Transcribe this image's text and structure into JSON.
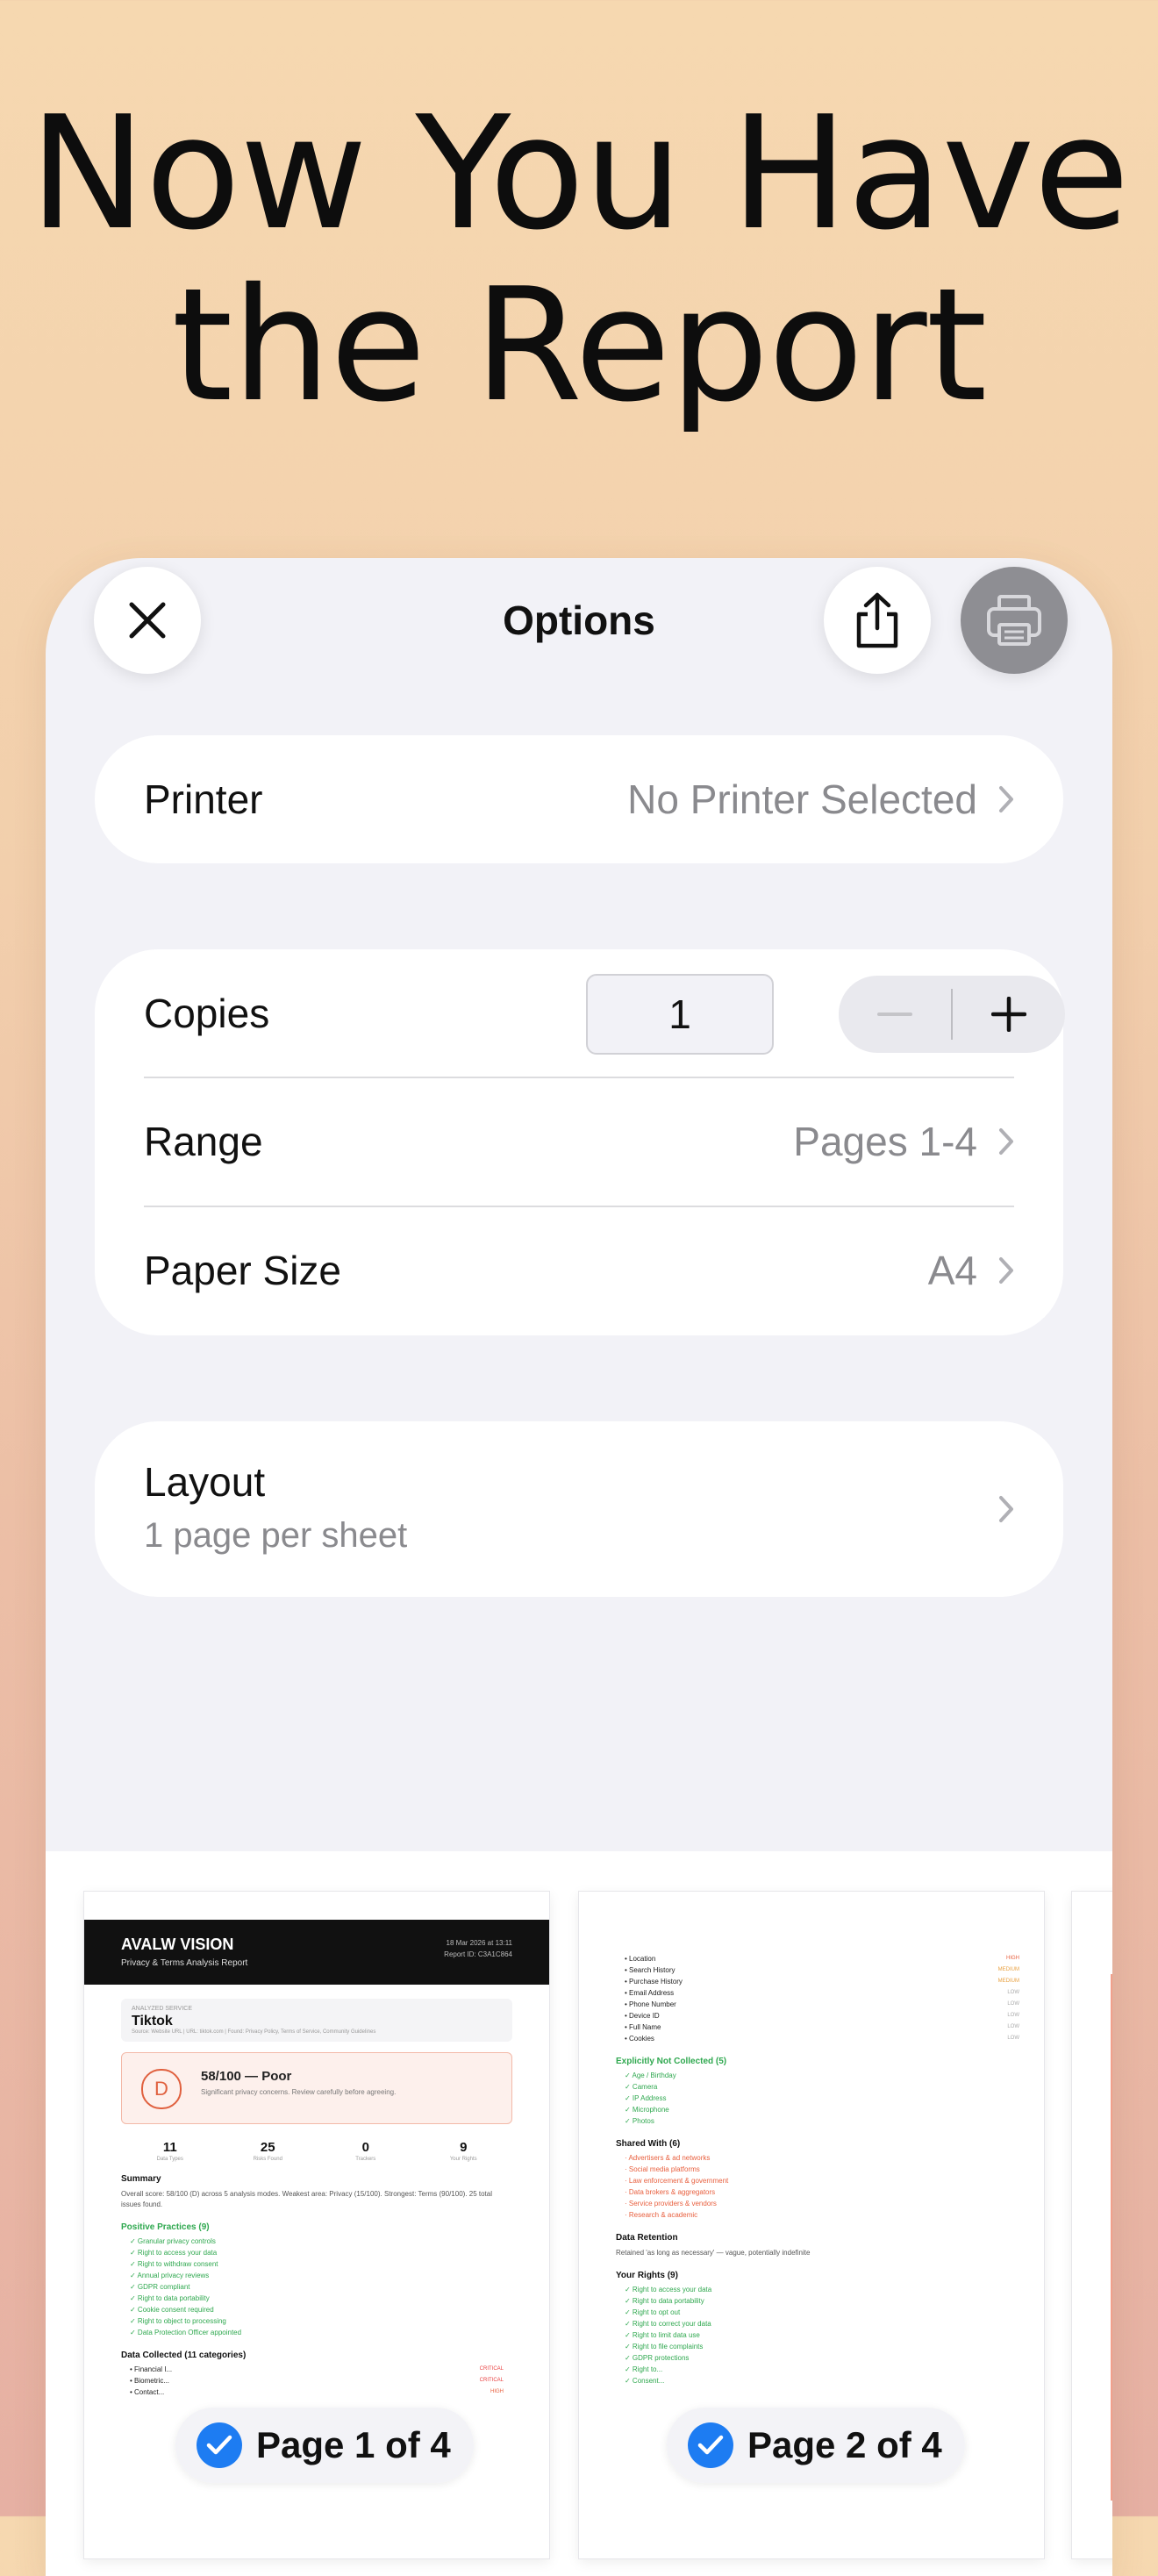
{
  "headline": {
    "line1": "Now You Have",
    "line2": "the Report"
  },
  "sheet": {
    "title": "Options",
    "close_icon": "close-icon",
    "share_icon": "share-icon",
    "print_icon": "printer-icon"
  },
  "printer": {
    "label": "Printer",
    "value": "No Printer Selected"
  },
  "copies": {
    "label": "Copies",
    "value": "1"
  },
  "range": {
    "label": "Range",
    "value": "Pages 1-4"
  },
  "paper_size": {
    "label": "Paper Size",
    "value": "A4"
  },
  "layout": {
    "label": "Layout",
    "value": "1 page per sheet"
  },
  "pages": {
    "page1_label": "Page 1 of 4",
    "page2_label": "Page 2 of 4"
  },
  "report_p1": {
    "brand": "AVALW VISION",
    "subtitle": "Privacy & Terms Analysis Report",
    "meta1": "18 Mar 2026 at 13:11",
    "meta2": "Report ID: C3A1C864",
    "service_caption": "ANALYZED SERVICE",
    "service_name": "Tiktok",
    "service_source": "Source: Website URL | URL: tiktok.com | Found: Privacy Policy, Terms of Service, Community Guidelines",
    "grade": "D",
    "score": "58/100 — Poor",
    "score_note": "Significant privacy concerns. Review carefully before agreeing.",
    "stats": [
      {
        "n": "11",
        "l": "Data Types"
      },
      {
        "n": "25",
        "l": "Risks Found"
      },
      {
        "n": "0",
        "l": "Trackers"
      },
      {
        "n": "9",
        "l": "Your Rights"
      }
    ],
    "summary_title": "Summary",
    "summary_text": "Overall score: 58/100 (D) across 5 analysis modes. Weakest area: Privacy (15/100). Strongest: Terms (90/100). 25 total issues found.",
    "positive_title": "Positive Practices (9)",
    "positive": [
      "✓ Granular privacy controls",
      "✓ Right to access your data",
      "✓ Right to withdraw consent",
      "✓ Annual privacy reviews",
      "✓ GDPR compliant",
      "✓ Right to data portability",
      "✓ Cookie consent required",
      "✓ Right to object to processing",
      "✓ Data Protection Officer appointed"
    ],
    "collected_title": "Data Collected (11 categories)",
    "collected": [
      {
        "t": "• Financial I...",
        "tag": "CRITICAL"
      },
      {
        "t": "• Biometric...",
        "tag": "CRITICAL"
      },
      {
        "t": "• Contact...",
        "tag": "HIGH"
      }
    ]
  },
  "report_p2": {
    "list": [
      {
        "t": "• Location",
        "tag": "HIGH"
      },
      {
        "t": "• Search History",
        "tag": "MEDIUM"
      },
      {
        "t": "• Purchase History",
        "tag": "MEDIUM"
      },
      {
        "t": "• Email Address",
        "tag": "LOW"
      },
      {
        "t": "• Phone Number",
        "tag": "LOW"
      },
      {
        "t": "• Device ID",
        "tag": "LOW"
      },
      {
        "t": "• Full Name",
        "tag": "LOW"
      },
      {
        "t": "• Cookies",
        "tag": "LOW"
      }
    ],
    "not_collected_title": "Explicitly Not Collected (5)",
    "not_collected": [
      "✓ Age / Birthday",
      "✓ Camera",
      "✓ IP Address",
      "✓ Microphone",
      "✓ Photos"
    ],
    "shared_title": "Shared With (6)",
    "shared": [
      "· Advertisers & ad networks",
      "· Social media platforms",
      "· Law enforcement & government",
      "· Data brokers & aggregators",
      "· Service providers & vendors",
      "· Research & academic"
    ],
    "retention_title": "Data Retention",
    "retention_text": "Retained 'as long as necessary' — vague, potentially indefinite",
    "rights_title": "Your Rights (9)",
    "rights": [
      "✓ Right to access your data",
      "✓ Right to data portability",
      "✓ Right to opt out",
      "✓ Right to correct your data",
      "✓ Right to limit data use",
      "✓ Right to file complaints",
      "✓ GDPR protections",
      "✓ Right to...",
      "✓ Consent..."
    ]
  }
}
